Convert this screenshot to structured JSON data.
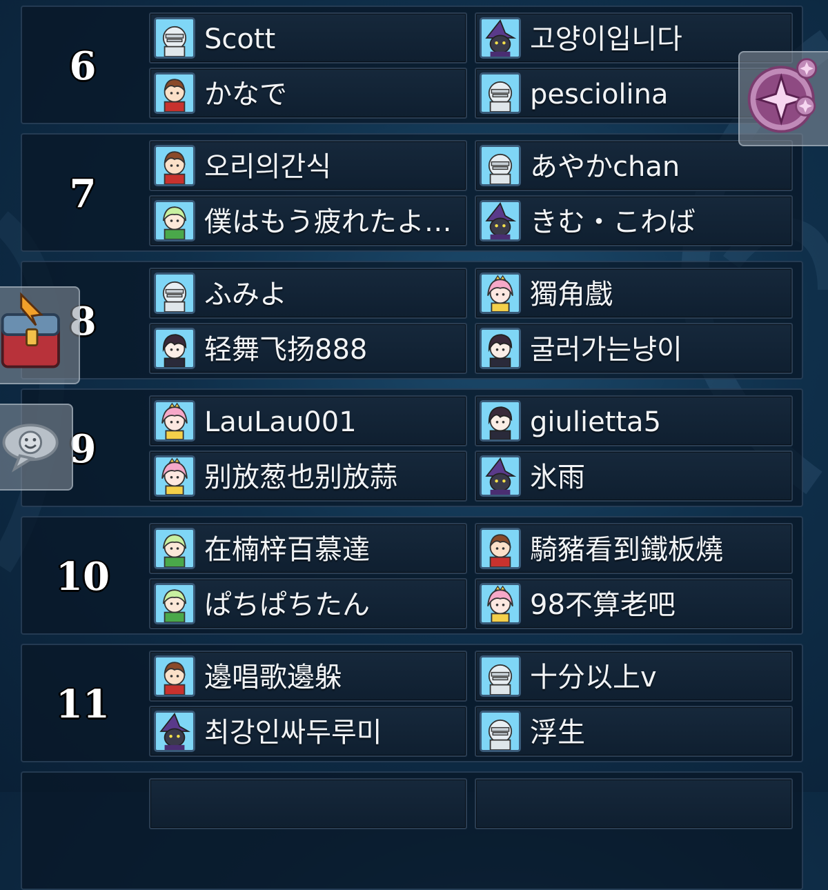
{
  "colors": {
    "background": "#0f2f4a",
    "row_panel": "#0a1828",
    "slot": "#13253a",
    "text": "#f2f4f6",
    "rank_text": "#ffffff"
  },
  "groups": [
    {
      "rank": "6",
      "players": [
        {
          "name": "Scott",
          "avatar": "knight-icon"
        },
        {
          "name": "고양이입니다",
          "avatar": "witch-cat-icon"
        },
        {
          "name": "かなで",
          "avatar": "brown-hair-girl-icon"
        },
        {
          "name": "pesciolina",
          "avatar": "knight-icon"
        }
      ]
    },
    {
      "rank": "7",
      "players": [
        {
          "name": "오리의간식",
          "avatar": "brown-hair-girl-icon"
        },
        {
          "name": "あやかchan",
          "avatar": "knight-icon"
        },
        {
          "name": "僕はもう疲れたよ…",
          "avatar": "green-elf-icon"
        },
        {
          "name": "きむ・こわば",
          "avatar": "witch-cat-icon"
        }
      ]
    },
    {
      "rank": "8",
      "players": [
        {
          "name": "ふみよ",
          "avatar": "knight-icon"
        },
        {
          "name": "獨角戲",
          "avatar": "pink-princess-icon"
        },
        {
          "name": "轻舞飞扬888",
          "avatar": "dark-hair-rogue-icon"
        },
        {
          "name": "굴러가는냥이",
          "avatar": "dark-hair-rogue-icon"
        }
      ]
    },
    {
      "rank": "9",
      "players": [
        {
          "name": "LauLau001",
          "avatar": "pink-princess-icon"
        },
        {
          "name": "giulietta5",
          "avatar": "dark-hair-rogue-icon"
        },
        {
          "name": "别放葱也别放蒜",
          "avatar": "pink-princess-icon"
        },
        {
          "name": "氷雨",
          "avatar": "witch-cat-icon"
        }
      ]
    },
    {
      "rank": "10",
      "players": [
        {
          "name": "在楠梓百慕達",
          "avatar": "green-elf-icon"
        },
        {
          "name": "騎豬看到鐵板燒",
          "avatar": "brown-hair-girl-icon"
        },
        {
          "name": "ぱちぱちたん",
          "avatar": "green-elf-icon"
        },
        {
          "name": "98不算老吧",
          "avatar": "pink-princess-icon"
        }
      ]
    },
    {
      "rank": "11",
      "players": [
        {
          "name": "邊唱歌邊躲",
          "avatar": "brown-hair-girl-icon"
        },
        {
          "name": "十分以上v",
          "avatar": "knight-icon"
        },
        {
          "name": "최강인싸두루미",
          "avatar": "witch-cat-icon"
        },
        {
          "name": "浮生",
          "avatar": "knight-icon"
        }
      ]
    }
  ],
  "side_buttons": {
    "sparkle": "sparkle-icon",
    "treasure": "treasure-chest-icon",
    "chat": "chat-bubble-icon"
  }
}
